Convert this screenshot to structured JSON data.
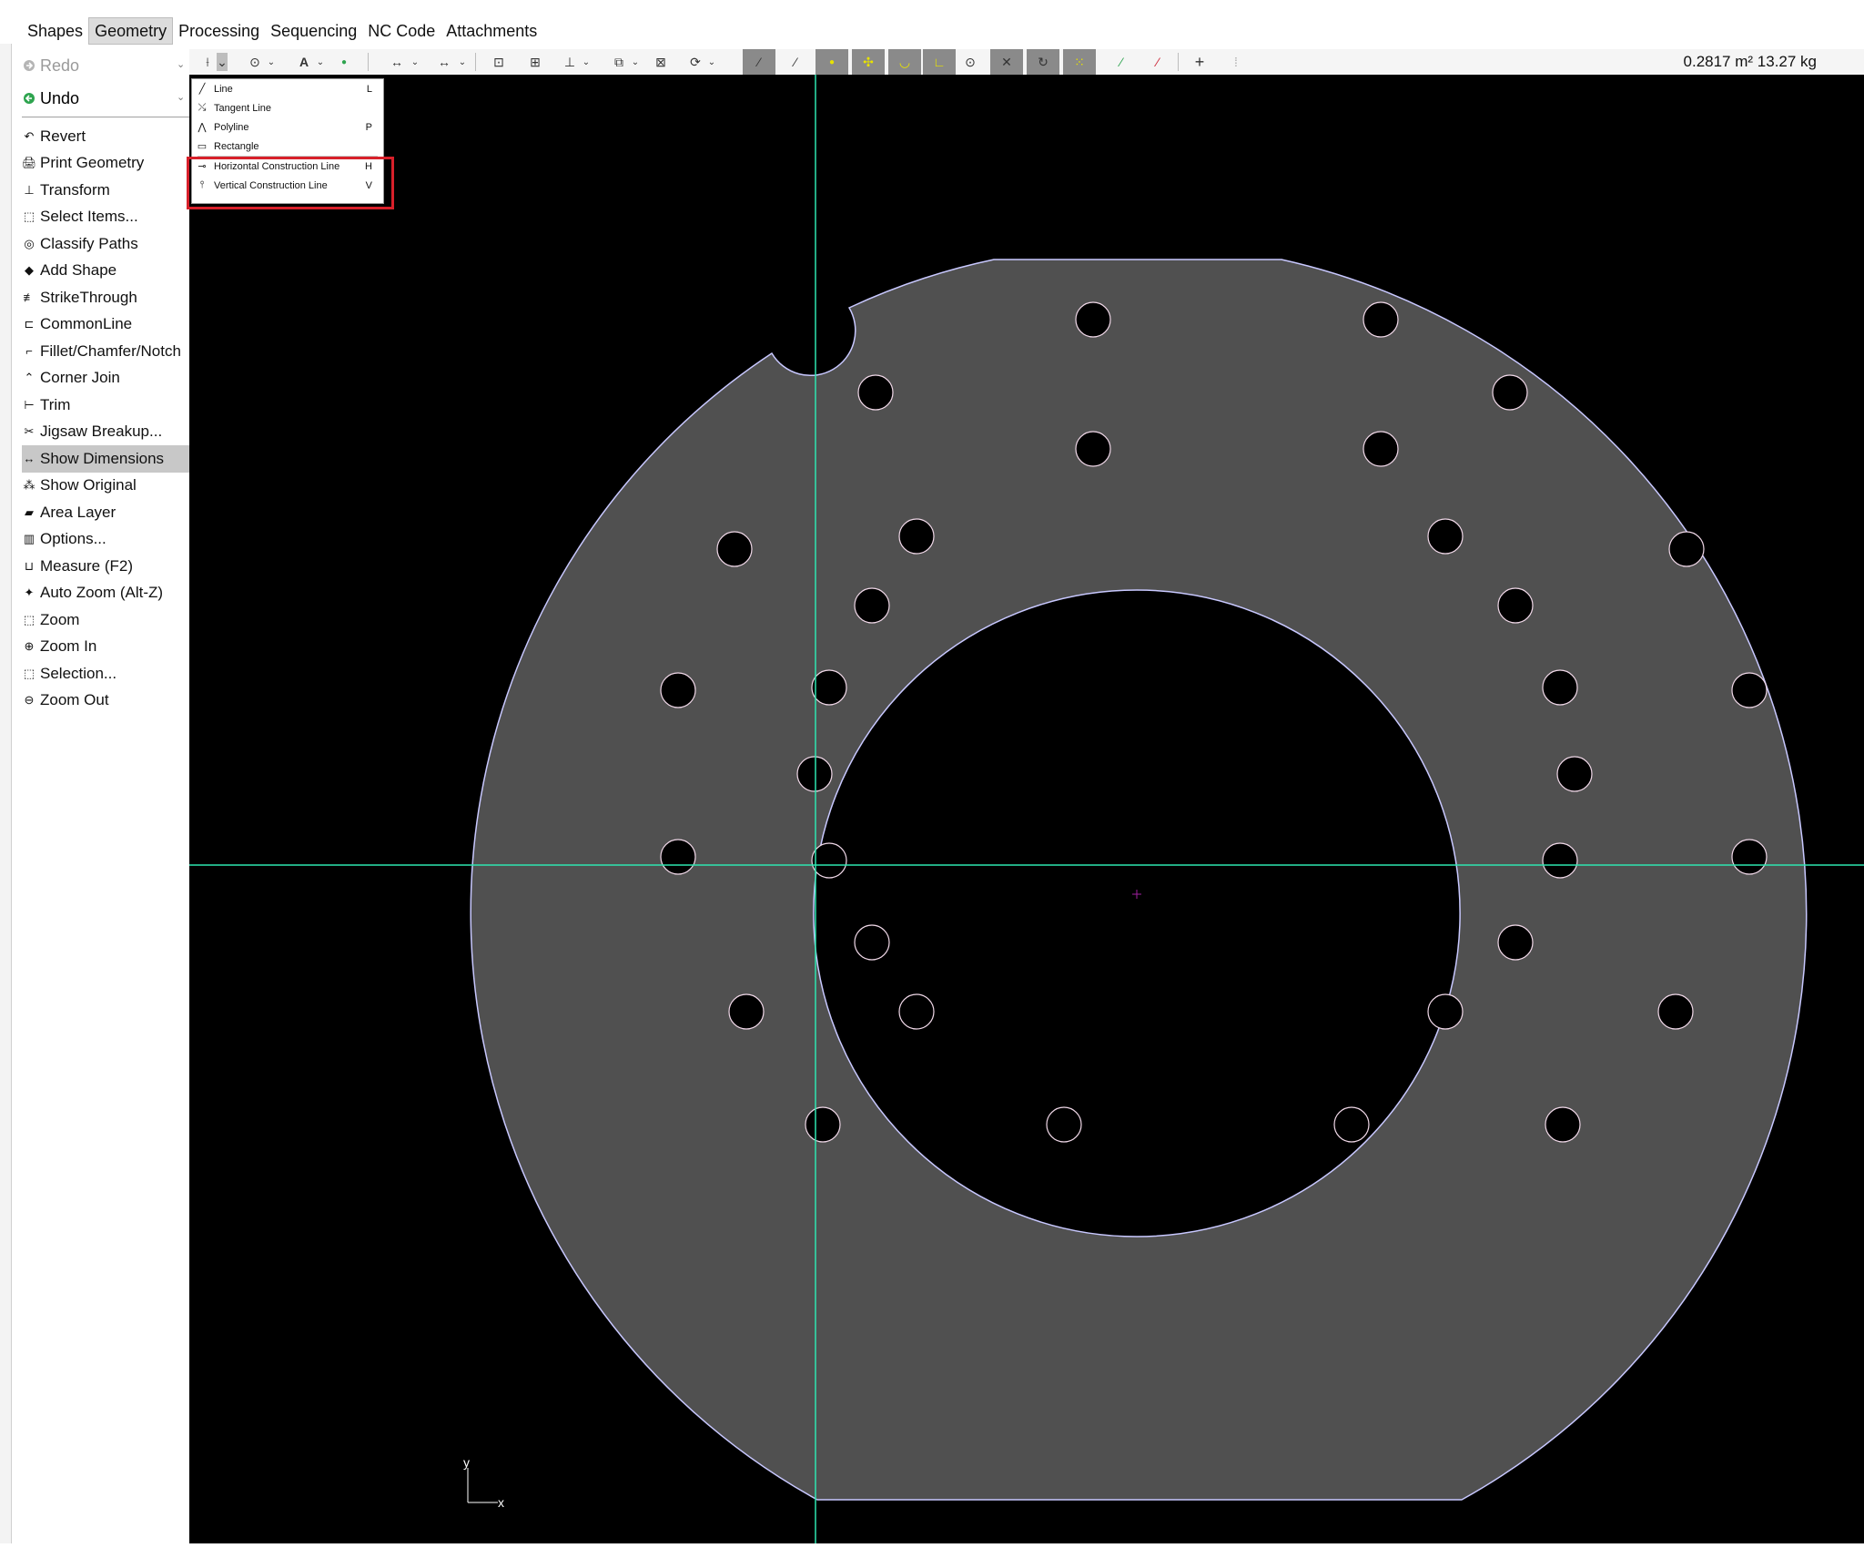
{
  "menu": {
    "items": [
      "Shapes",
      "Geometry",
      "Processing",
      "Sequencing",
      "NC Code",
      "Attachments"
    ],
    "active": "Geometry"
  },
  "sidebar": {
    "redo_label": "Redo",
    "undo_label": "Undo",
    "items": [
      {
        "label": "Revert",
        "icon": "revert-icon"
      },
      {
        "label": "Print Geometry",
        "icon": "print-icon"
      },
      {
        "label": "Transform",
        "icon": "transform-icon"
      },
      {
        "label": "Select Items...",
        "icon": "select-icon"
      },
      {
        "label": "Classify Paths",
        "icon": "classify-icon"
      },
      {
        "label": "Add Shape",
        "icon": "add-shape-icon"
      },
      {
        "label": "StrikeThrough",
        "icon": "strikethrough-icon"
      },
      {
        "label": "CommonLine",
        "icon": "commonline-icon"
      },
      {
        "label": "Fillet/Chamfer/Notch",
        "icon": "fillet-icon"
      },
      {
        "label": "Corner Join",
        "icon": "corner-join-icon"
      },
      {
        "label": "Trim",
        "icon": "trim-icon"
      },
      {
        "label": "Jigsaw Breakup...",
        "icon": "jigsaw-icon"
      },
      {
        "label": "Show Dimensions",
        "icon": "dimensions-icon",
        "selected": true
      },
      {
        "label": "Show Original",
        "icon": "show-original-icon"
      },
      {
        "label": "Area Layer",
        "icon": "area-layer-icon"
      },
      {
        "label": "Options...",
        "icon": "options-icon"
      },
      {
        "label": "Measure (F2)",
        "icon": "measure-icon"
      },
      {
        "label": "Auto Zoom (Alt-Z)",
        "icon": "auto-zoom-icon"
      },
      {
        "label": "Zoom",
        "icon": "zoom-icon"
      },
      {
        "label": "Zoom In",
        "icon": "zoom-in-icon"
      },
      {
        "label": "Selection...",
        "icon": "selection-icon"
      },
      {
        "label": "Zoom Out",
        "icon": "zoom-out-icon"
      }
    ]
  },
  "toolbar": {
    "readout": "0.2817 m² 13.27 kg"
  },
  "dropdown": {
    "items": [
      {
        "label": "Line",
        "key": "L",
        "icon": "line-icon"
      },
      {
        "label": "Tangent Line",
        "key": "",
        "icon": "tangent-line-icon"
      },
      {
        "label": "Polyline",
        "key": "P",
        "icon": "polyline-icon"
      },
      {
        "label": "Rectangle",
        "key": "",
        "icon": "rectangle-icon"
      },
      {
        "label": "Horizontal Construction Line",
        "key": "H",
        "icon": "horizontal-construction-line-icon"
      },
      {
        "label": "Vertical Construction Line",
        "key": "V",
        "icon": "vertical-construction-line-icon"
      }
    ]
  },
  "axis": {
    "x_label": "x",
    "y_label": "y"
  },
  "colors": {
    "canvas": "#000000",
    "part_fill": "#505050",
    "construction_line": "#2ee6b0",
    "highlight": "#d8202a",
    "selected_item": "#c8c8c8"
  }
}
